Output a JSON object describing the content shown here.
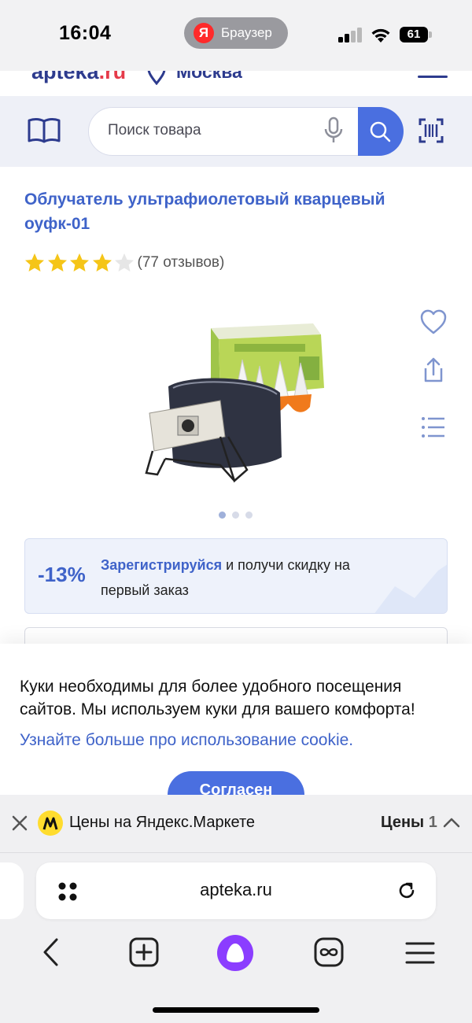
{
  "status_bar": {
    "time": "16:04",
    "browser_app_badge": "Я",
    "browser_app_label": "Браузер",
    "battery": "61"
  },
  "site_header": {
    "logo_main": "apteka",
    "logo_suffix": ".ru",
    "city": "Москва",
    "search_placeholder": "Поиск товара"
  },
  "product": {
    "title": "Облучатель ультрафиолетовый кварцевый оуфк-01",
    "rating": 4,
    "rating_max": 5,
    "reviews": "(77 отзывов)",
    "gallery_pages": 3,
    "gallery_active": 0
  },
  "promo": {
    "discount": "-13%",
    "link": "Зарегистрируйся",
    "text_after_link": " и получи скидку на первый заказ"
  },
  "cookie": {
    "text": "Куки необходимы для более удобного посещения сайтов. Мы используем куки для вашего комфорта!",
    "link": "Узнайте больше про использование cookie.",
    "agree_button": "Согласен"
  },
  "market": {
    "label": "Цены на Яндекс.Маркете",
    "prices_label": "Цены",
    "prices_count": "1"
  },
  "browser": {
    "url": "apteka.ru"
  },
  "colors": {
    "brand_blue": "#3f63c9",
    "button_blue": "#4a6fe0",
    "star_gold": "#f5c518",
    "alice_purple": "#8b3dff"
  }
}
